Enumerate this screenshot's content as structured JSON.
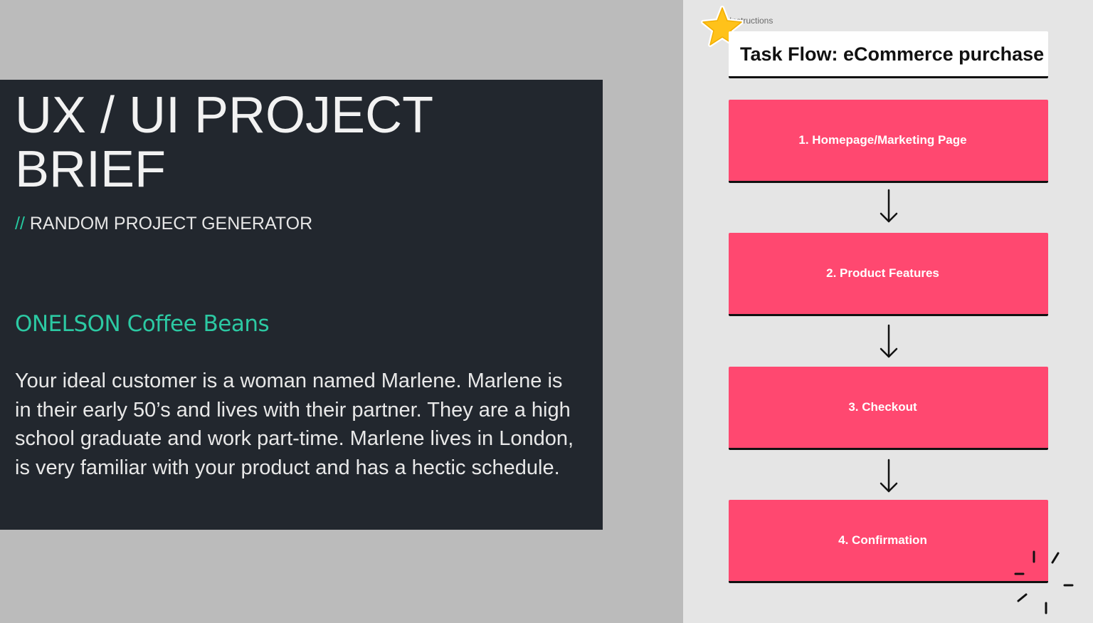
{
  "brief": {
    "title": "UX / UI PROJECT BRIEF",
    "subtitle_prefix": "//",
    "subtitle": "RANDOM PROJECT GENERATOR",
    "brand": "ONELSON Coffee Beans",
    "body": "Your ideal customer is a woman named Marlene. Marlene is in their early 50’s and lives with their partner. They are a high school graduate and work part-time. Marlene lives in London, is very familiar with your product and has a hectic schedule."
  },
  "board": {
    "instructions_label": "Instructions",
    "title": "Task Flow: eCommerce purchase",
    "steps": [
      {
        "label": "1. Homepage/Marketing Page"
      },
      {
        "label": "2. Product Features"
      },
      {
        "label": "3. Checkout"
      },
      {
        "label": "4. Confirmation"
      }
    ]
  },
  "colors": {
    "card_bg": "#22272e",
    "accent_teal": "#2cc9a3",
    "step_pink": "#ff4870",
    "star_yellow": "#ffc21a"
  },
  "icons": {
    "star": "star-sticker-icon",
    "arrow": "arrow-down-icon",
    "sparkle": "sparkle-doodle-icon"
  }
}
